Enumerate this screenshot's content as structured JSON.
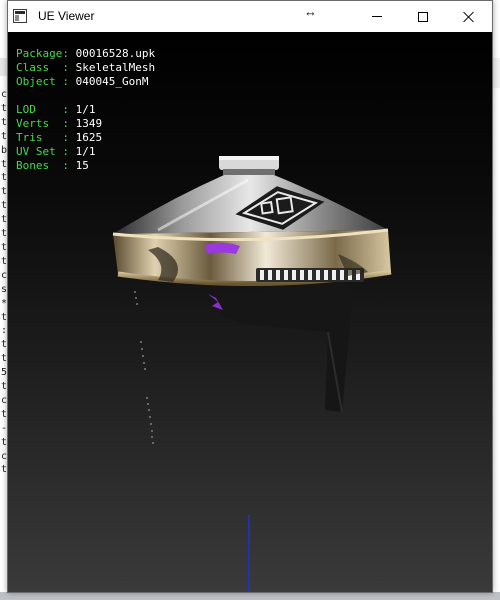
{
  "window": {
    "title": "UE Viewer",
    "icon": "app-icon",
    "controls": {
      "minimize": "minimize-icon",
      "maximize": "maximize-icon",
      "close": "close-icon",
      "move": "↔"
    }
  },
  "info": {
    "package": {
      "label": "Package:",
      "value": "00016528.upk"
    },
    "class": {
      "label": "Class  :",
      "value": "SkeletalMesh"
    },
    "object": {
      "label": "Object :",
      "value": "040045_GonM"
    },
    "lod": {
      "label": "LOD    :",
      "value": "1/1"
    },
    "verts": {
      "label": "Verts  :",
      "value": "1349"
    },
    "tris": {
      "label": "Tris   :",
      "value": "1625"
    },
    "uvset": {
      "label": "UV Set :",
      "value": "1/1"
    },
    "bones": {
      "label": "Bones  :",
      "value": "15"
    }
  },
  "colors": {
    "label": "#47d84f",
    "value": "#ffffff",
    "axis": "#1f2fd8",
    "hat_silver": "#c8c8c8",
    "hat_gold": "#c9a35a",
    "accent_purple": "#9b38e0"
  },
  "background_console": {
    "left_chars": [
      "c",
      "t",
      "t",
      "t",
      "b",
      "t",
      "t",
      "t",
      "t",
      "t",
      "t",
      "t",
      "t",
      "c",
      "s",
      "*",
      "t",
      ":",
      "t",
      "t",
      "5",
      "t",
      "c",
      "t",
      "-",
      "t",
      "c",
      "t"
    ],
    "right_chars": [
      "",
      "",
      "",
      "",
      "",
      "",
      "",
      "",
      "",
      "",
      "",
      "",
      "",
      "",
      "",
      "",
      "",
      "",
      "",
      "",
      "",
      "",
      "",
      "",
      "",
      "",
      "",
      ""
    ]
  }
}
